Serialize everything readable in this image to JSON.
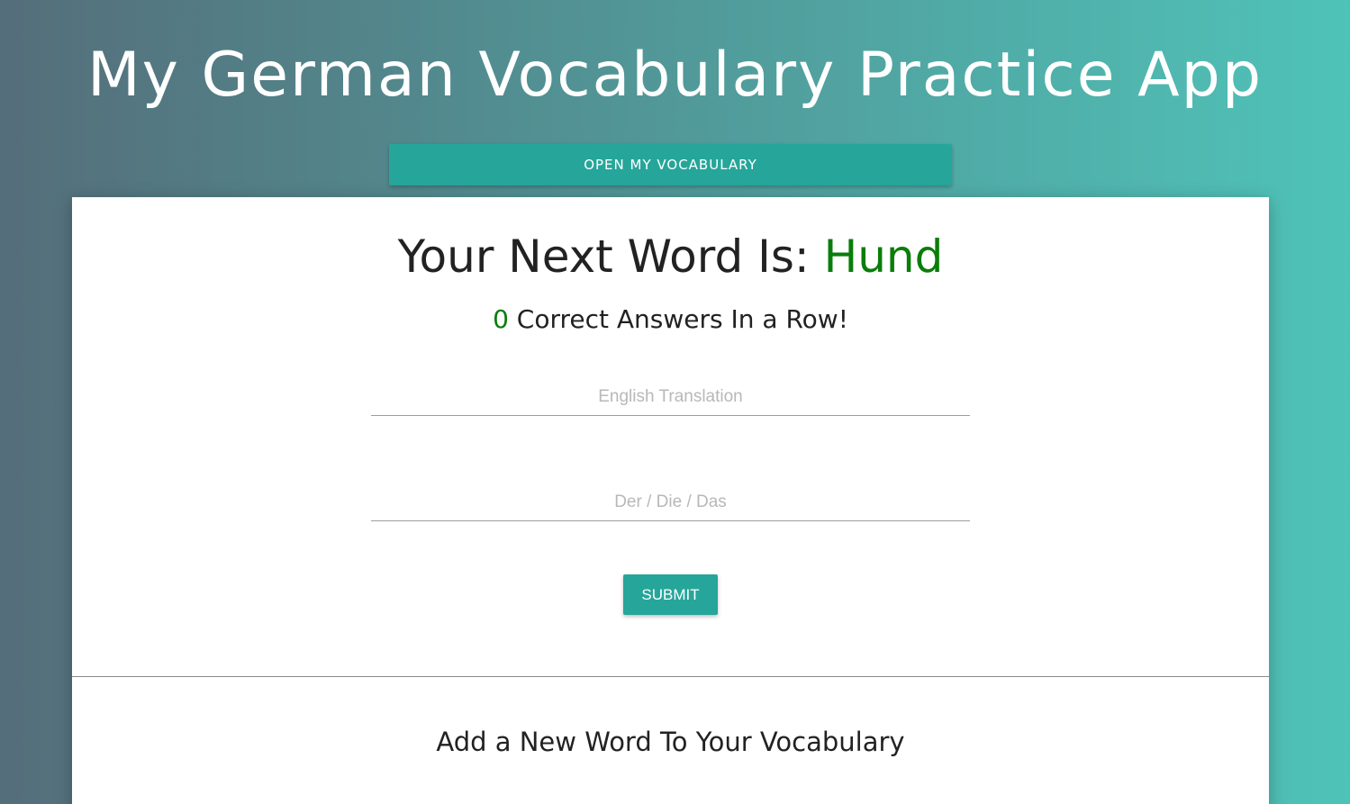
{
  "app": {
    "title": "My German Vocabulary Practice App"
  },
  "toolbar": {
    "open_vocab_label": "OPEN MY VOCABULARY"
  },
  "quiz": {
    "heading_prefix": "Your Next Word Is:",
    "current_word": "Hund",
    "streak_count": "0",
    "streak_label": "Correct Answers In a Row!",
    "translation_placeholder": "English Translation",
    "article_placeholder": "Der / Die / Das",
    "submit_label": "SUBMIT"
  },
  "add_word": {
    "heading": "Add a New Word To Your Vocabulary"
  },
  "colors": {
    "accent": "#26a69a",
    "word_highlight": "#0a7d0a",
    "gradient_start": "#546e7a",
    "gradient_end": "#4fc3b8"
  }
}
